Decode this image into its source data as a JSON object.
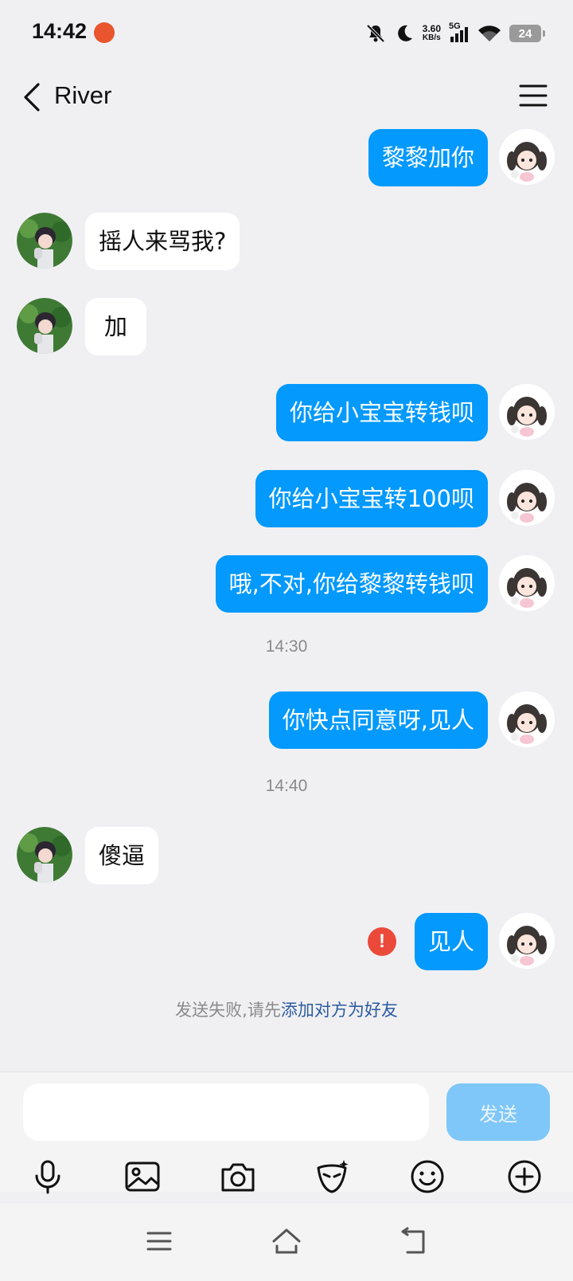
{
  "status_bar": {
    "time": "14:42",
    "net_speed_value": "3.60",
    "net_speed_unit": "KB/s",
    "network": "5G",
    "battery": "24"
  },
  "header": {
    "title": "River"
  },
  "messages": [
    {
      "side": "right",
      "text": "黎黎加你"
    },
    {
      "side": "left",
      "text": "摇人来骂我?"
    },
    {
      "side": "left",
      "text": "加"
    },
    {
      "side": "right",
      "text": "你给小宝宝转钱呗"
    },
    {
      "side": "right",
      "text": "你给小宝宝转100呗"
    },
    {
      "side": "right",
      "text": "哦,不对,你给黎黎转钱呗"
    },
    {
      "timestamp": "14:30"
    },
    {
      "side": "right",
      "text": "你快点同意呀,见人"
    },
    {
      "timestamp": "14:40"
    },
    {
      "side": "left",
      "text": "傻逼"
    },
    {
      "side": "right",
      "text": "见人",
      "failed": true
    }
  ],
  "failure_notice": {
    "prefix": "发送失败,请先",
    "link": "添加对方为好友"
  },
  "input": {
    "value": "",
    "send_label": "发送"
  },
  "toolbar": [
    "microphone-icon",
    "image-icon",
    "camera-icon",
    "sticker-icon",
    "emoji-icon",
    "plus-icon"
  ],
  "colors": {
    "outgoing_bubble": "#0399fd",
    "incoming_bubble": "#ffffff",
    "background": "#f0f0f3",
    "send_disabled": "#7fc7f8",
    "error": "#eb4a3b",
    "link": "#2c5aa0"
  }
}
